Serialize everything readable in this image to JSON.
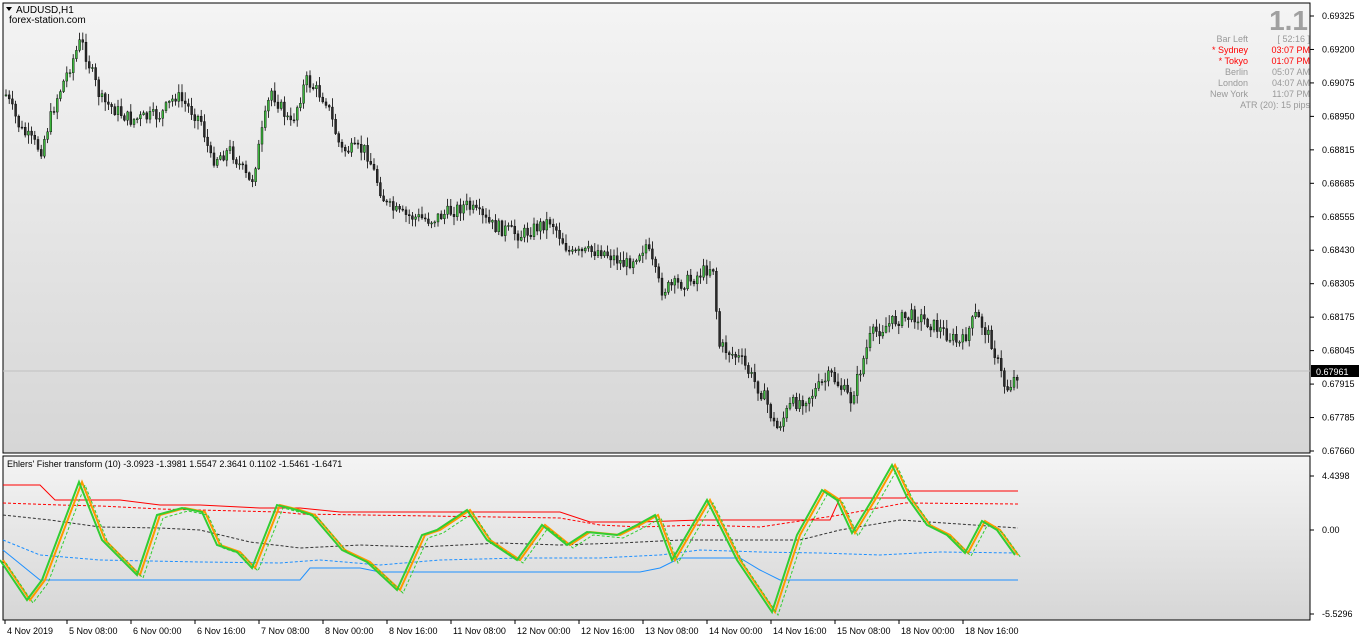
{
  "header": {
    "symbol_timeframe": "AUDUSD,H1",
    "site": "forex-station.com"
  },
  "info_panel": {
    "big_value": "1.1",
    "rows": [
      {
        "label": "Bar Left",
        "value": "[ 52:16 ]",
        "color": "#999999"
      },
      {
        "label": "* Sydney",
        "value": "03:07 PM",
        "color": "#ff0000"
      },
      {
        "label": "* Tokyo",
        "value": "01:07 PM",
        "color": "#ff0000"
      },
      {
        "label": "Berlin",
        "value": "05:07 AM",
        "color": "#999999"
      },
      {
        "label": "London",
        "value": "04:07 AM",
        "color": "#999999"
      },
      {
        "label": "New York",
        "value": "11:07 PM",
        "color": "#999999"
      }
    ],
    "atr": "ATR (20): 15 pips"
  },
  "price_axis": {
    "labels": [
      "0.69325",
      "0.69200",
      "0.69075",
      "0.68950",
      "0.68815",
      "0.68685",
      "0.68555",
      "0.68430",
      "0.68305",
      "0.68175",
      "0.68045",
      "0.67915",
      "0.67785",
      "0.67660"
    ],
    "current_price": "0.67961"
  },
  "indicator": {
    "title": "Ehlers' Fisher transform (10) -3.0923 -1.3981 1.5547 2.3641 0.1102 -1.5461 -1.6471",
    "axis_labels": [
      "4.4398",
      "0.00",
      "-5.5296"
    ]
  },
  "time_axis": {
    "labels": [
      "4 Nov 2019",
      "5 Nov 08:00",
      "6 Nov 00:00",
      "6 Nov 16:00",
      "7 Nov 08:00",
      "8 Nov 00:00",
      "8 Nov 16:00",
      "11 Nov 08:00",
      "12 Nov 00:00",
      "12 Nov 16:00",
      "13 Nov 08:00",
      "14 Nov 00:00",
      "14 Nov 16:00",
      "15 Nov 08:00",
      "18 Nov 00:00",
      "18 Nov 16:00"
    ]
  },
  "colors": {
    "bull_candle": "#2e8b2e",
    "bear_candle": "#3a2a1a",
    "fisher_main": "#32cd32",
    "fisher_signal": "#ff9900",
    "upper_band": "#ff0000",
    "lower_band": "#1e90ff",
    "mid_band": "#333333"
  }
}
